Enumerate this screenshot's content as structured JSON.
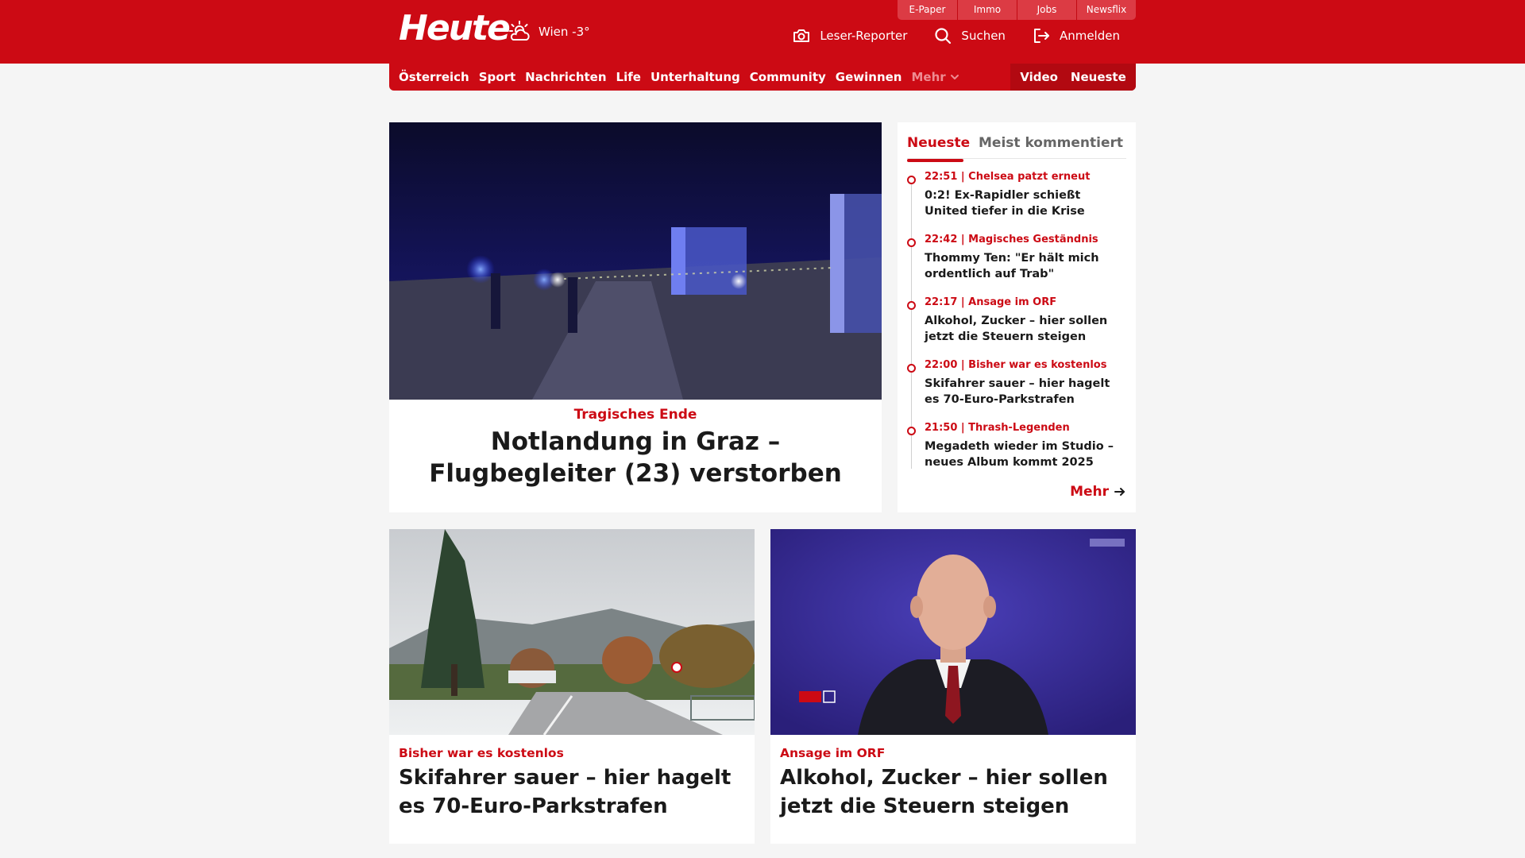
{
  "header": {
    "logo": "Heute",
    "weather": "Wien -3°",
    "service_tabs": [
      "E-Paper",
      "Immo",
      "Jobs",
      "Newsflix"
    ],
    "actions": {
      "reporter": "Leser-Reporter",
      "search": "Suchen",
      "login": "Anmelden"
    }
  },
  "nav": {
    "items": [
      "Österreich",
      "Sport",
      "Nachrichten",
      "Life",
      "Unterhaltung",
      "Community",
      "Gewinnen"
    ],
    "more": "Mehr",
    "right": [
      "Video",
      "Neueste"
    ]
  },
  "hero": {
    "kicker": "Tragisches Ende",
    "title": "Notlandung in Graz – Flugbegleiter (23) verstorben"
  },
  "sidebar": {
    "tabs": {
      "active": "Neueste",
      "inactive": "Meist kommentiert"
    },
    "items": [
      {
        "meta": "22:51 | Chelsea patzt erneut",
        "title": "0:2! Ex-Rapidler schießt United tiefer in die Krise"
      },
      {
        "meta": "22:42 | Magisches Geständnis",
        "title": "Thommy Ten: \"Er hält mich ordentlich auf Trab\""
      },
      {
        "meta": "22:17 | Ansage im ORF",
        "title": "Alkohol, Zucker – hier sollen jetzt die Steuern steigen"
      },
      {
        "meta": "22:00 | Bisher war es kostenlos",
        "title": "Skifahrer sauer – hier hagelt es 70-Euro-Parkstrafen"
      },
      {
        "meta": "21:50 | Thrash-Legenden",
        "title": "Megadeth wieder im Studio – neues Album kommt 2025"
      }
    ],
    "more": "Mehr"
  },
  "cards": [
    {
      "kicker": "Bisher war es kostenlos",
      "title": "Skifahrer sauer – hier hagelt es 70-Euro-Parkstrafen"
    },
    {
      "kicker": "Ansage im ORF",
      "title": "Alkohol, Zucker – hier sollen jetzt die Steuern steigen"
    }
  ],
  "colors": {
    "brand": "#cc0a14",
    "brand_dark": "#b20911",
    "background": "#f5f5f5"
  }
}
